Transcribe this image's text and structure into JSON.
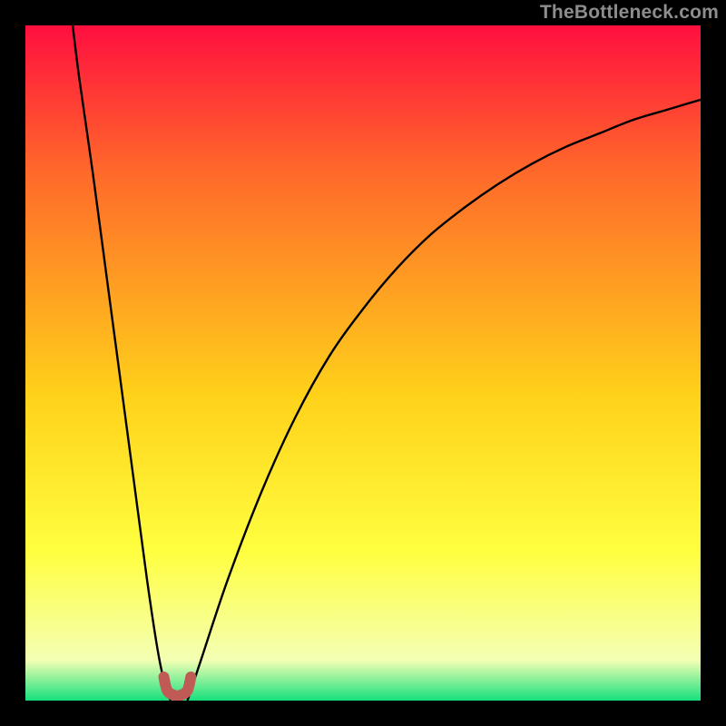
{
  "watermark": "TheBottleneck.com",
  "colors": {
    "frame": "#000000",
    "gradient_top": "#ff0f3f",
    "gradient_mid1": "#ff6a2a",
    "gradient_mid2": "#ffd21a",
    "gradient_mid3": "#ffff40",
    "gradient_low": "#f4ffb4",
    "gradient_bottom": "#16e07d",
    "curve": "#000000",
    "marker": "#c05a55"
  },
  "chart_data": {
    "type": "line",
    "title": "",
    "xlabel": "",
    "ylabel": "",
    "xlim": [
      0,
      100
    ],
    "ylim": [
      0,
      100
    ],
    "series": [
      {
        "name": "bottleneck-curve-left",
        "x": [
          7,
          8,
          10,
          12,
          14,
          16,
          18,
          19.5,
          20.5,
          21.5
        ],
        "values": [
          100,
          92,
          78,
          63,
          48,
          33,
          18,
          8,
          3,
          0
        ]
      },
      {
        "name": "bottleneck-curve-right",
        "x": [
          24,
          26,
          30,
          35,
          40,
          45,
          50,
          55,
          60,
          65,
          70,
          75,
          80,
          85,
          90,
          95,
          100
        ],
        "values": [
          0,
          6,
          18,
          31,
          42,
          51,
          58,
          64,
          69,
          73,
          76.5,
          79.5,
          82,
          84,
          86,
          87.5,
          89
        ]
      },
      {
        "name": "optimal-marker",
        "x": [
          20.5,
          21,
          22,
          23,
          24,
          24.5
        ],
        "values": [
          3.5,
          1.5,
          0.8,
          0.8,
          1.5,
          3.5
        ]
      }
    ],
    "optimum_x": 22.5
  }
}
